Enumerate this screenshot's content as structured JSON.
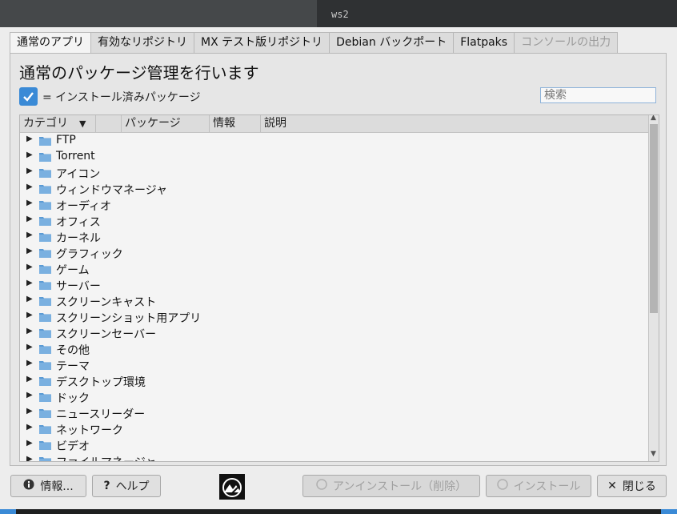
{
  "window": {
    "title": "ws2"
  },
  "tabs": [
    {
      "label": "通常のアプリ"
    },
    {
      "label": "有効なリポジトリ"
    },
    {
      "label": "MX テスト版リポジトリ"
    },
    {
      "label": "Debian バックポート"
    },
    {
      "label": "Flatpaks"
    },
    {
      "label": "コンソールの出力"
    }
  ],
  "main": {
    "heading": "通常のパッケージ管理を行います",
    "legend_text": "= インストール済みパッケージ",
    "search_placeholder": "検索"
  },
  "table": {
    "columns": [
      "カテゴリ",
      "",
      "パッケージ",
      "情報",
      "説明"
    ],
    "sort_indicator": "▼",
    "rows": [
      {
        "label": "FTP"
      },
      {
        "label": "Torrent"
      },
      {
        "label": "アイコン"
      },
      {
        "label": "ウィンドウマネージャ"
      },
      {
        "label": "オーディオ"
      },
      {
        "label": "オフィス"
      },
      {
        "label": "カーネル"
      },
      {
        "label": "グラフィック"
      },
      {
        "label": "ゲーム"
      },
      {
        "label": "サーバー"
      },
      {
        "label": "スクリーンキャスト"
      },
      {
        "label": "スクリーンショット用アプリ"
      },
      {
        "label": "スクリーンセーバー"
      },
      {
        "label": "その他"
      },
      {
        "label": "テーマ"
      },
      {
        "label": "デスクトップ環境"
      },
      {
        "label": "ドック"
      },
      {
        "label": "ニュースリーダー"
      },
      {
        "label": "ネットワーク"
      },
      {
        "label": "ビデオ"
      },
      {
        "label": "ファイルマネージャ"
      }
    ]
  },
  "buttons": {
    "info": "情報...",
    "help": "ヘルプ",
    "uninstall": "アンインストール（削除）",
    "install": "インストール",
    "close": "閉じる"
  },
  "icons": {
    "info": "info-icon",
    "help": "question-icon",
    "uninstall": "trash-icon",
    "install": "download-icon",
    "close": "close-icon",
    "category": "folder-icon",
    "expand": "expand-arrow-icon",
    "logo": "mx-logo-icon"
  },
  "colors": {
    "accent": "#3a8ad6",
    "folder": "#5b9bd5"
  }
}
